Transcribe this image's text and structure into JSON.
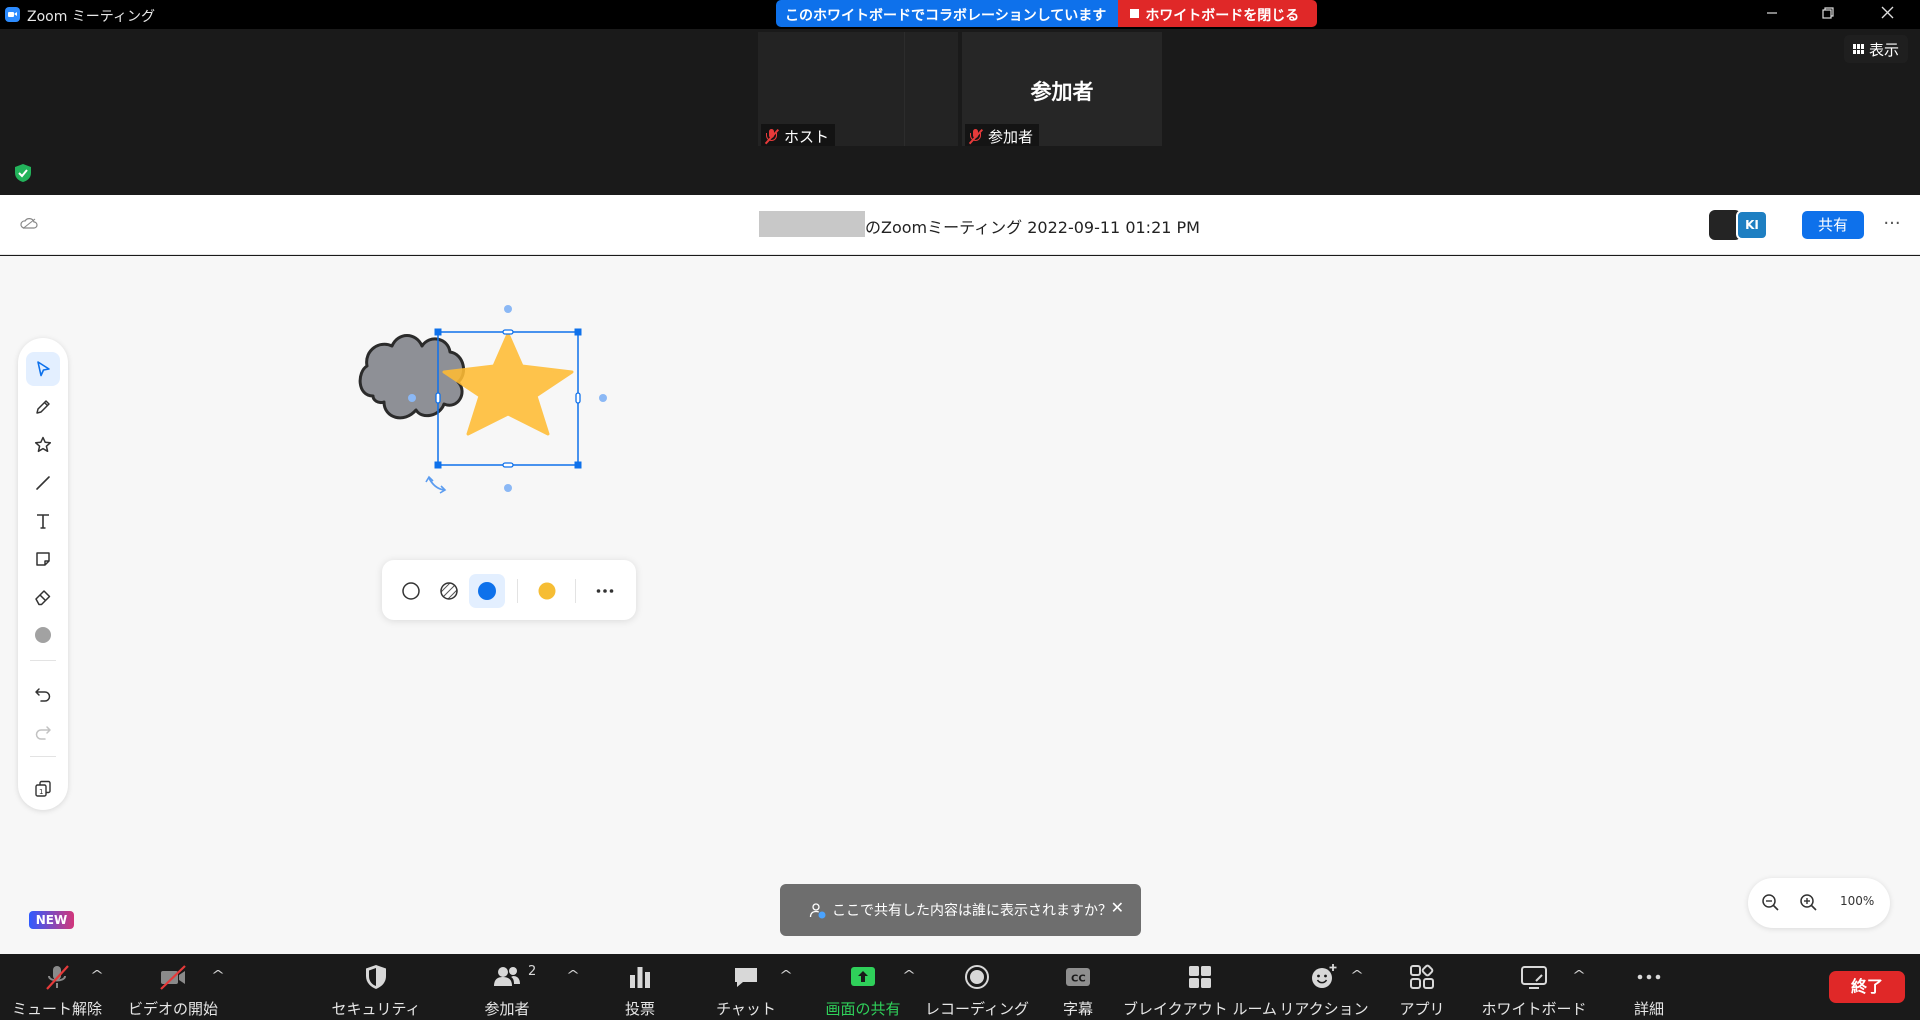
{
  "window": {
    "app_title": "Zoom ミーティング",
    "icons": {
      "minimize": "minimize-icon",
      "restore": "restore-icon",
      "close": "close-icon"
    }
  },
  "banner": {
    "collab_text": "このホワイトボードでコラボレーションしています",
    "close_text": "ホワイトボードを閉じる",
    "collab_color": "#0e71eb",
    "close_color": "#e02828"
  },
  "gallery": {
    "host_label": "ホスト",
    "participant_name": "参加者",
    "participant_label": "参加者",
    "view_button": "表示"
  },
  "whiteboard": {
    "title": "のZoomミーティング 2022-09-11 01:21 PM",
    "avatar_initials": "KI",
    "share_button": "共有",
    "accent_color": "#0e71eb"
  },
  "tools": [
    {
      "name": "select",
      "icon": "cursor-arrow-icon",
      "active": true
    },
    {
      "name": "pen",
      "icon": "pencil-icon"
    },
    {
      "name": "shapes",
      "icon": "star-outline-icon"
    },
    {
      "name": "line",
      "icon": "line-icon"
    },
    {
      "name": "text",
      "icon": "text-t-icon"
    },
    {
      "name": "sticky-note",
      "icon": "sticky-note-icon"
    },
    {
      "name": "eraser",
      "icon": "eraser-icon"
    },
    {
      "name": "color",
      "icon": "color-dot-icon"
    },
    {
      "name": "undo",
      "icon": "undo-icon"
    },
    {
      "name": "redo",
      "icon": "redo-icon"
    },
    {
      "name": "pages",
      "icon": "pages-icon"
    }
  ],
  "canvas_shapes": {
    "cloud_fill": "#8e9096",
    "star_fill": "#ffbc34",
    "selection_color": "#0e71eb"
  },
  "context_toolbar": {
    "options": [
      "no-fill-icon",
      "hatched-fill-icon",
      "solid-fill-icon",
      "color-swatch-icon",
      "more-icon"
    ],
    "active_option": "solid-fill-icon",
    "swatch_color": "#f6bd34"
  },
  "badge_new": "NEW",
  "toast": {
    "text": "ここで共有した内容は誰に表示されますか？"
  },
  "zoom": {
    "percent": "100%"
  },
  "controls": {
    "mute": "ミュート解除",
    "video": "ビデオの開始",
    "security": "セキュリティ",
    "participants": "参加者",
    "participants_count": "2",
    "poll": "投票",
    "chat": "チャット",
    "share_screen": "画面の共有",
    "recording": "レコーディング",
    "captions": "字幕",
    "breakout": "ブレイクアウト ルーム",
    "reactions": "リアクション",
    "apps": "アプリ",
    "whiteboard": "ホワイトボード",
    "more": "詳細",
    "end": "終了",
    "share_color": "#2fd05a",
    "end_color": "#e02828"
  }
}
